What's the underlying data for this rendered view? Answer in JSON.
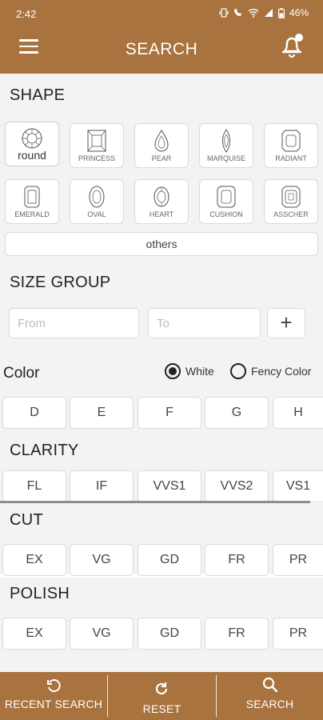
{
  "status_bar": {
    "time": "2:42",
    "battery": "46%"
  },
  "header": {
    "title": "SEARCH"
  },
  "shape": {
    "title": "SHAPE",
    "items": [
      "round",
      "PRINCESS",
      "PEAR",
      "MARQUISE",
      "RADIANT",
      "EMERALD",
      "OVAL",
      "HEART",
      "CUSHION",
      "ASSCHER"
    ],
    "others_label": "others"
  },
  "size_group": {
    "title": "SIZE GROUP",
    "from_placeholder": "From",
    "to_placeholder": "To",
    "add_label": "+"
  },
  "color": {
    "title": "Color",
    "white_label": "White",
    "fancy_label": "Fency Color",
    "options": [
      "D",
      "E",
      "F",
      "G",
      "H"
    ]
  },
  "clarity": {
    "title": "CLARITY",
    "options": [
      "FL",
      "IF",
      "VVS1",
      "VVS2",
      "VS1"
    ]
  },
  "cut": {
    "title": "CUT",
    "options": [
      "EX",
      "VG",
      "GD",
      "FR",
      "PR"
    ]
  },
  "polish": {
    "title": "POLISH",
    "options": [
      "EX",
      "VG",
      "GD",
      "FR",
      "PR"
    ]
  },
  "bottom_nav": {
    "recent": "RECENT SEARCH",
    "reset": "RESET",
    "search": "SEARCH"
  },
  "colors": {
    "brand": "#a8733e",
    "section_bg": "#f3f3f3"
  }
}
